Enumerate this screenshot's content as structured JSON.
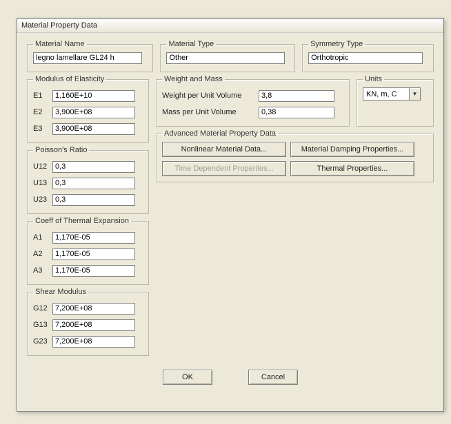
{
  "title": "Material Property Data",
  "groups": {
    "material_name": "Material Name",
    "material_type": "Material Type",
    "symmetry_type": "Symmetry Type",
    "modulus": "Modulus of Elasticity",
    "weight_mass": "Weight and Mass",
    "units": "Units",
    "poisson": "Poisson's Ratio",
    "thermal": "Coeff of Thermal Expansion",
    "shear": "Shear Modulus",
    "advanced": "Advanced Material Property Data"
  },
  "material_name": "legno lamellare GL24 h",
  "material_type": "Other",
  "symmetry_type": "Orthotropic",
  "modulus": {
    "E1": {
      "label": "E1",
      "value": "1,160E+10"
    },
    "E2": {
      "label": "E2",
      "value": "3,900E+08"
    },
    "E3": {
      "label": "E3",
      "value": "3,900E+08"
    }
  },
  "weight_mass": {
    "wpuv": {
      "label": "Weight per Unit Volume",
      "value": "3,8"
    },
    "mpuv": {
      "label": "Mass per Unit Volume",
      "value": "0,38"
    }
  },
  "units": {
    "selected": "KN, m, C"
  },
  "poisson": {
    "U12": {
      "label": "U12",
      "value": "0,3"
    },
    "U13": {
      "label": "U13",
      "value": "0,3"
    },
    "U23": {
      "label": "U23",
      "value": "0,3"
    }
  },
  "thermal": {
    "A1": {
      "label": "A1",
      "value": "1,170E-05"
    },
    "A2": {
      "label": "A2",
      "value": "1,170E-05"
    },
    "A3": {
      "label": "A3",
      "value": "1,170E-05"
    }
  },
  "shear": {
    "G12": {
      "label": "G12",
      "value": "7,200E+08"
    },
    "G13": {
      "label": "G13",
      "value": "7,200E+08"
    },
    "G23": {
      "label": "G23",
      "value": "7,200E+08"
    }
  },
  "advanced": {
    "nonlinear": "Nonlinear Material Data...",
    "damping": "Material Damping Properties...",
    "timedep": "Time Dependent Properties...",
    "therm": "Thermal Properties..."
  },
  "buttons": {
    "ok": "OK",
    "cancel": "Cancel"
  }
}
